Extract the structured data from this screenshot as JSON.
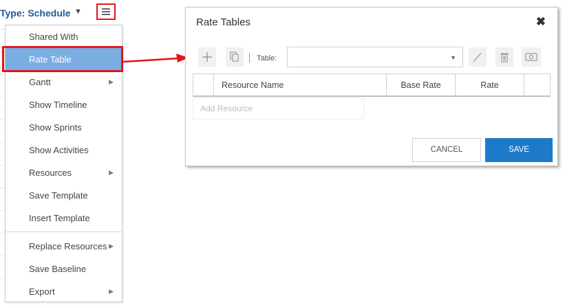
{
  "header": {
    "type_label": "Type:",
    "type_value": "Schedule"
  },
  "menu": {
    "items": [
      {
        "label": "Shared With",
        "has_submenu": false
      },
      {
        "label": "Rate Table",
        "has_submenu": false,
        "selected": true
      },
      {
        "label": "Gantt",
        "has_submenu": true
      },
      {
        "label": "Show Timeline",
        "has_submenu": false
      },
      {
        "label": "Show Sprints",
        "has_submenu": false
      },
      {
        "label": "Show Activities",
        "has_submenu": false
      },
      {
        "label": "Resources",
        "has_submenu": true
      },
      {
        "label": "Save Template",
        "has_submenu": false
      },
      {
        "label": "Insert Template",
        "has_submenu": false
      },
      {
        "label": "Replace Resources",
        "has_submenu": true
      },
      {
        "label": "Save Baseline",
        "has_submenu": false
      },
      {
        "label": "Export",
        "has_submenu": true
      }
    ]
  },
  "dialog": {
    "title": "Rate Tables",
    "toolbar": {
      "table_label": "Table:",
      "table_value": ""
    },
    "grid": {
      "columns": [
        "Resource Name",
        "Base Rate",
        "Rate"
      ]
    },
    "add_resource_placeholder": "Add Resource",
    "cancel_label": "CANCEL",
    "save_label": "SAVE"
  },
  "colors": {
    "accent": "#1e7ac9",
    "selection": "#7aaee3",
    "highlight": "#e0161b",
    "type_text": "#1a5a96"
  }
}
